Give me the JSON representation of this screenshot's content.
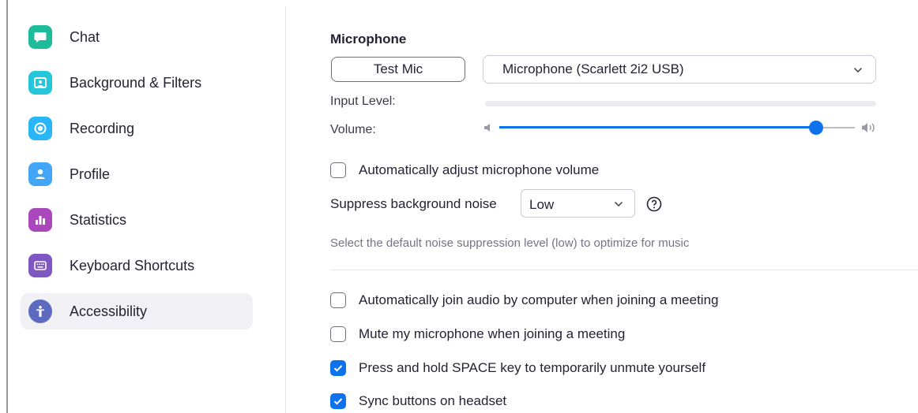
{
  "sidebar": {
    "items": [
      {
        "label": "Chat",
        "icon": "chat-icon",
        "color": "#1fbc9c"
      },
      {
        "label": "Background & Filters",
        "icon": "background-icon",
        "color": "#26c6da"
      },
      {
        "label": "Recording",
        "icon": "recording-icon",
        "color": "#29b6f6"
      },
      {
        "label": "Profile",
        "icon": "profile-icon",
        "color": "#42a5f5"
      },
      {
        "label": "Statistics",
        "icon": "statistics-icon",
        "color": "#ab47bc"
      },
      {
        "label": "Keyboard Shortcuts",
        "icon": "keyboard-icon",
        "color": "#7e57c2"
      },
      {
        "label": "Accessibility",
        "icon": "accessibility-icon",
        "color": "#5c6bc0"
      }
    ],
    "active": "Accessibility"
  },
  "microphone": {
    "section_title": "Microphone",
    "test_button": "Test Mic",
    "device_selected": "Microphone (Scarlett 2i2 USB)",
    "input_level_label": "Input Level:",
    "input_level": 0,
    "volume_label": "Volume:",
    "volume": 0.89
  },
  "options": {
    "auto_adjust": {
      "label": "Automatically adjust microphone volume",
      "checked": false
    },
    "suppress_label": "Suppress background noise",
    "suppress_selected": "Low",
    "suppress_hint": "Select the default noise suppression level (low) to optimize for music",
    "auto_join": {
      "label": "Automatically join audio by computer when joining a meeting",
      "checked": false
    },
    "mute_on_join": {
      "label": "Mute my microphone when joining a meeting",
      "checked": false
    },
    "space_unmute": {
      "label": "Press and hold SPACE key to temporarily unmute yourself",
      "checked": true
    },
    "sync_headset": {
      "label": "Sync buttons on headset",
      "checked": true
    }
  },
  "colors": {
    "accent": "#0e72ed",
    "text": "#232333",
    "muted_text": "#747487"
  }
}
